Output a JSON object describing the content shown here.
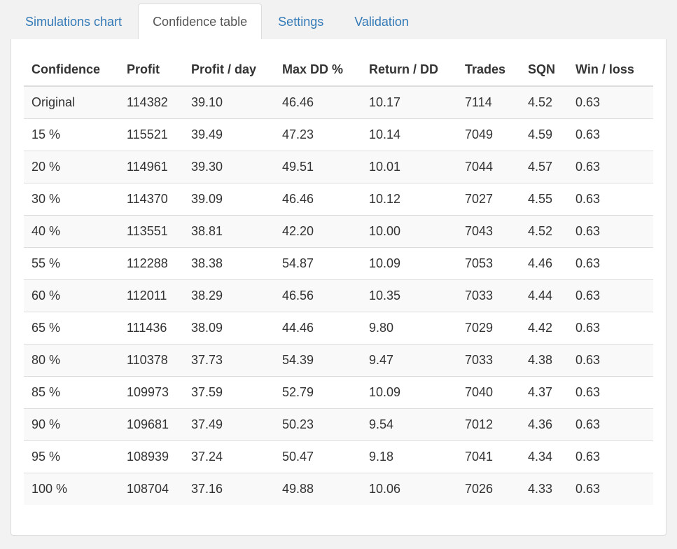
{
  "tabs": [
    {
      "label": "Simulations chart",
      "active": false
    },
    {
      "label": "Confidence table",
      "active": true
    },
    {
      "label": "Settings",
      "active": false
    },
    {
      "label": "Validation",
      "active": false
    }
  ],
  "table": {
    "headers": [
      "Confidence",
      "Profit",
      "Profit / day",
      "Max DD %",
      "Return / DD",
      "Trades",
      "SQN",
      "Win / loss"
    ],
    "rows": [
      [
        "Original",
        "114382",
        "39.10",
        "46.46",
        "10.17",
        "7114",
        "4.52",
        "0.63"
      ],
      [
        "15 %",
        "115521",
        "39.49",
        "47.23",
        "10.14",
        "7049",
        "4.59",
        "0.63"
      ],
      [
        "20 %",
        "114961",
        "39.30",
        "49.51",
        "10.01",
        "7044",
        "4.57",
        "0.63"
      ],
      [
        "30 %",
        "114370",
        "39.09",
        "46.46",
        "10.12",
        "7027",
        "4.55",
        "0.63"
      ],
      [
        "40 %",
        "113551",
        "38.81",
        "42.20",
        "10.00",
        "7043",
        "4.52",
        "0.63"
      ],
      [
        "55 %",
        "112288",
        "38.38",
        "54.87",
        "10.09",
        "7053",
        "4.46",
        "0.63"
      ],
      [
        "60 %",
        "112011",
        "38.29",
        "46.56",
        "10.35",
        "7033",
        "4.44",
        "0.63"
      ],
      [
        "65 %",
        "111436",
        "38.09",
        "44.46",
        "9.80",
        "7029",
        "4.42",
        "0.63"
      ],
      [
        "80 %",
        "110378",
        "37.73",
        "54.39",
        "9.47",
        "7033",
        "4.38",
        "0.63"
      ],
      [
        "85 %",
        "109973",
        "37.59",
        "52.79",
        "10.09",
        "7040",
        "4.37",
        "0.63"
      ],
      [
        "90 %",
        "109681",
        "37.49",
        "50.23",
        "9.54",
        "7012",
        "4.36",
        "0.63"
      ],
      [
        "95 %",
        "108939",
        "37.24",
        "50.47",
        "9.18",
        "7041",
        "4.34",
        "0.63"
      ],
      [
        "100 %",
        "108704",
        "37.16",
        "49.88",
        "10.06",
        "7026",
        "4.33",
        "0.63"
      ]
    ]
  },
  "colors": {
    "link": "#337ab7",
    "active_tab_text": "#555555",
    "border": "#dddddd",
    "stripe": "#f9f9f9",
    "background": "#f2f2f2"
  }
}
